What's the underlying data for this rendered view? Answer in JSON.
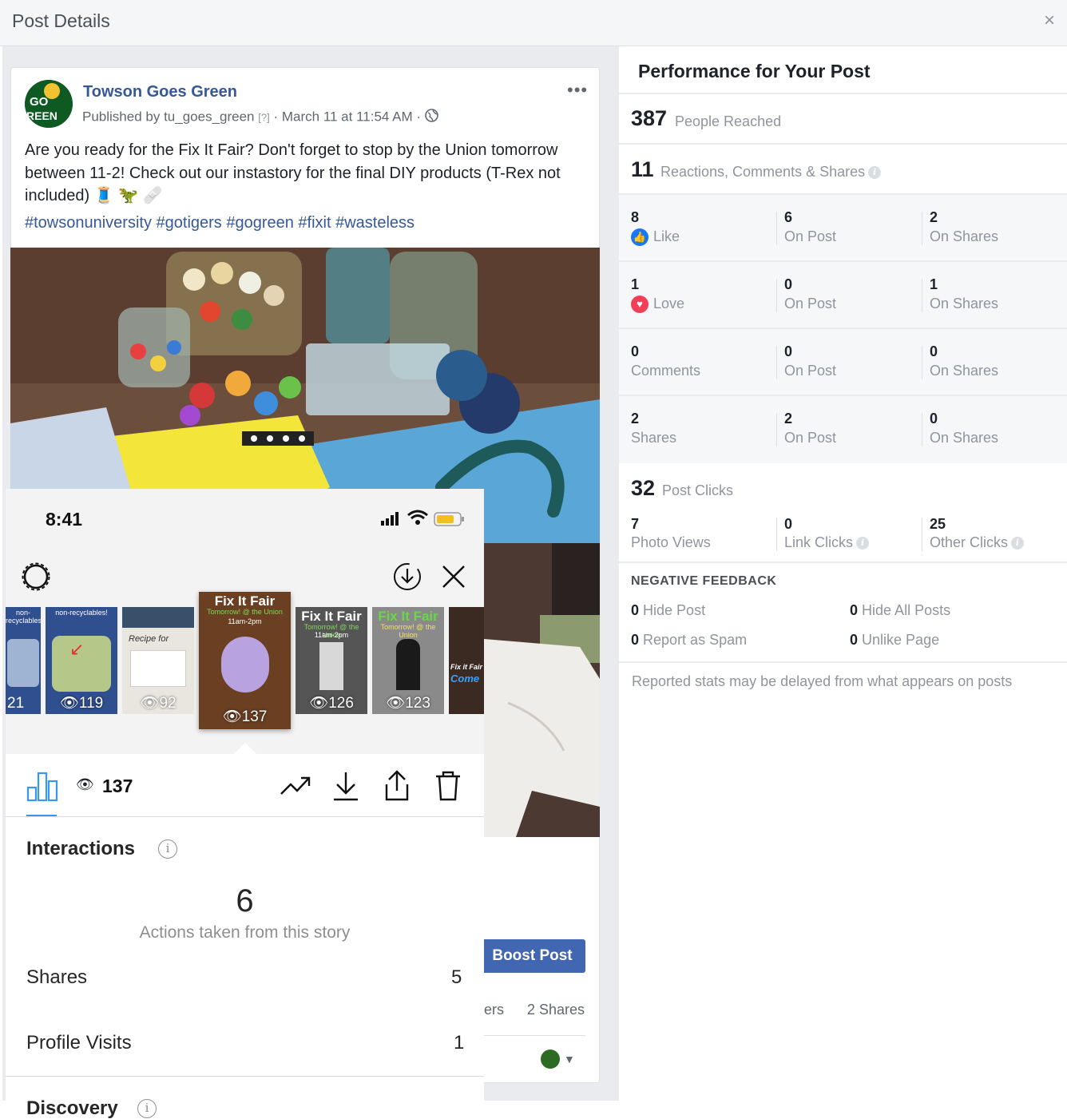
{
  "header": {
    "title": "Post Details",
    "close": "×"
  },
  "post": {
    "page_name": "Towson Goes Green",
    "published_by_prefix": "Published by",
    "publisher": "tu_goes_green",
    "help": "[?]",
    "date": "March 11 at 11:54 AM",
    "more": "•••",
    "text": "Are you ready for the Fix It Fair? Don't forget to stop by the Union tomorrow between 11-2! Check out our instastory for the final DIY products (T-Rex not included) 🧵 🦖 🩹",
    "hashtags": "#towsonuniversity #gotigers #gogreen #fixit #wasteless",
    "boost_label": "Boost Post",
    "shares_fragment": "ers",
    "shares_count": "2 Shares",
    "avatar_text": "GO GREEN"
  },
  "performance": {
    "title": "Performance for Your Post",
    "reach_value": "387",
    "reach_label": "People Reached",
    "engagement_value": "11",
    "engagement_label": "Reactions, Comments & Shares",
    "rows": [
      {
        "total": "8",
        "label": "Like",
        "on_post": "6",
        "on_post_label": "On Post",
        "on_shares": "2",
        "on_shares_label": "On Shares"
      },
      {
        "total": "1",
        "label": "Love",
        "on_post": "0",
        "on_post_label": "On Post",
        "on_shares": "1",
        "on_shares_label": "On Shares"
      },
      {
        "total": "0",
        "label": "Comments",
        "on_post": "0",
        "on_post_label": "On Post",
        "on_shares": "0",
        "on_shares_label": "On Shares"
      },
      {
        "total": "2",
        "label": "Shares",
        "on_post": "2",
        "on_post_label": "On Post",
        "on_shares": "0",
        "on_shares_label": "On Shares"
      }
    ],
    "clicks_value": "32",
    "clicks_label": "Post Clicks",
    "photo_views": "7",
    "photo_views_label": "Photo Views",
    "link_clicks": "0",
    "link_clicks_label": "Link Clicks",
    "other_clicks": "25",
    "other_clicks_label": "Other Clicks",
    "negative_title": "NEGATIVE FEEDBACK",
    "hide_post": "0",
    "hide_post_label": "Hide Post",
    "hide_all": "0",
    "hide_all_label": "Hide All Posts",
    "report_spam": "0",
    "report_spam_label": "Report as Spam",
    "unlike_page": "0",
    "unlike_page_label": "Unlike Page",
    "footnote": "Reported stats may be delayed from what appears on posts"
  },
  "story": {
    "time": "8:41",
    "thumbs": [
      {
        "count": "21",
        "label": "non-recyclables!"
      },
      {
        "count": "119",
        "label": "non-recyclables!"
      },
      {
        "count": "92",
        "label": "Recipe for"
      },
      {
        "count": "137",
        "title": "Fix It Fair",
        "sub": "Tomorrow! @ the Union",
        "sub2": "11am-2pm"
      },
      {
        "count": "126",
        "title": "Fix It Fair",
        "sub": "Tomorrow! @ the Union",
        "sub2": "11am-2pm"
      },
      {
        "count": "123",
        "title": "Fix It Fair",
        "sub": "Tomorrow! @ the Union"
      },
      {
        "count": "",
        "title": "Fix it Fair",
        "sub": "Come"
      }
    ],
    "views": "137",
    "interactions_title": "Interactions",
    "actions_value": "6",
    "actions_label": "Actions taken from this story",
    "shares_label": "Shares",
    "shares_value": "5",
    "profile_visits_label": "Profile Visits",
    "profile_visits_value": "1",
    "discovery_title": "Discovery"
  },
  "colors": {
    "link": "#365899",
    "boost": "#4267b2",
    "ig_blue": "#3897f0",
    "like_blue": "#1877f2",
    "love_red": "#f33e58"
  }
}
